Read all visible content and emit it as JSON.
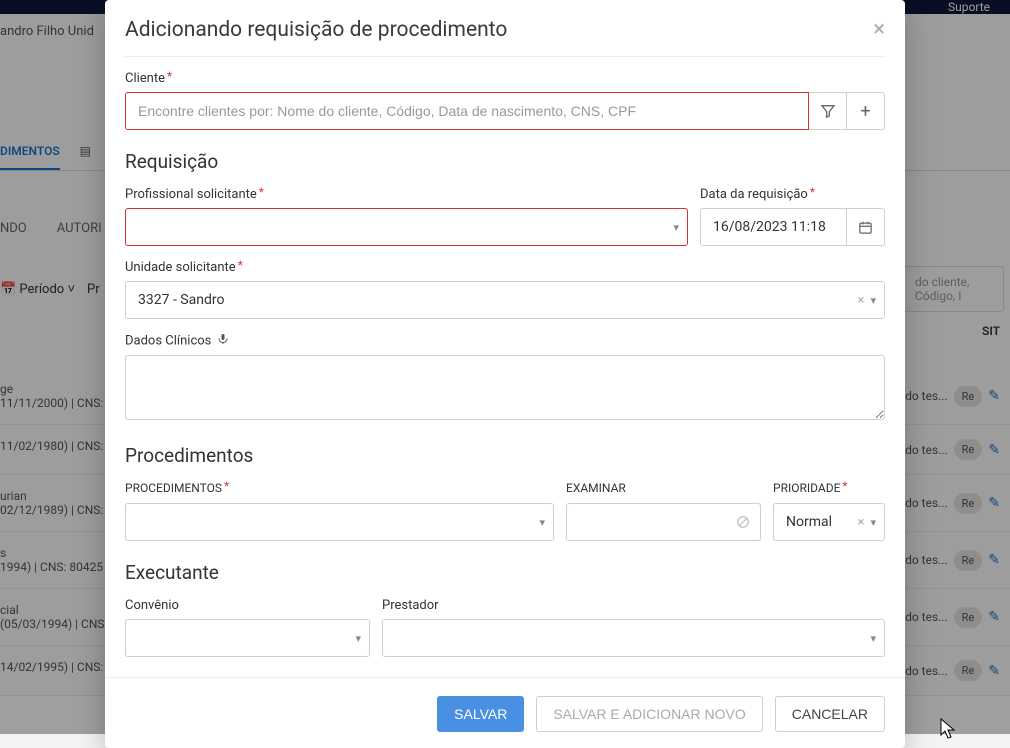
{
  "bg": {
    "suporte": "Suporte",
    "header_user": "andro Filho Unid",
    "tab_procedimentos": "DIMENTOS",
    "subtab_pending": "NDO",
    "subtab_auth": "AUTORI",
    "periodo": "Período",
    "pr": "Pr",
    "search_placeholder": "do cliente, Código, I",
    "sit": "SIT",
    "rows": [
      {
        "line1": "ge",
        "line2": "11/11/2000) | CNS:",
        "right": "ento do tes...",
        "badge": "Re"
      },
      {
        "line1": "",
        "line2": "11/02/1980) | CNS:",
        "right": "ento do tes...",
        "badge": "Re"
      },
      {
        "line1": "urian",
        "line2": "02/12/1989) | CNS:",
        "right": "ento do tes...",
        "badge": "Re"
      },
      {
        "line1": "s",
        "line2": "1994) | CNS: 80425",
        "right": "ento do tes...",
        "badge": "Re"
      },
      {
        "line1": "cial",
        "line2": "(05/03/1994) | CNS:",
        "right": "ento do tes...",
        "badge": "Re"
      },
      {
        "line1": "",
        "line2": "14/02/1995) | CNS:",
        "right": "ento do tes...",
        "badge": "Re"
      }
    ]
  },
  "modal": {
    "title": "Adicionando requisição de procedimento",
    "cliente": {
      "label": "Cliente",
      "placeholder": "Encontre clientes por: Nome do cliente, Código, Data de nascimento, CNS, CPF"
    },
    "requisicao": {
      "title": "Requisição",
      "profissional_label": "Profissional solicitante",
      "data_label": "Data da requisição",
      "data_value": "16/08/2023 11:18",
      "unidade_label": "Unidade solicitante",
      "unidade_value": "3327 - Sandro",
      "dados_label": "Dados Clínicos"
    },
    "procedimentos": {
      "title": "Procedimentos",
      "col_proc": "PROCEDIMENTOS",
      "col_exam": "EXAMINAR",
      "col_prio": "PRIORIDADE",
      "prio_value": "Normal"
    },
    "executante": {
      "title": "Executante",
      "convenio_label": "Convênio",
      "prestador_label": "Prestador"
    },
    "footer": {
      "salvar": "SALVAR",
      "salvar_novo": "SALVAR E ADICIONAR NOVO",
      "cancelar": "CANCELAR"
    }
  }
}
